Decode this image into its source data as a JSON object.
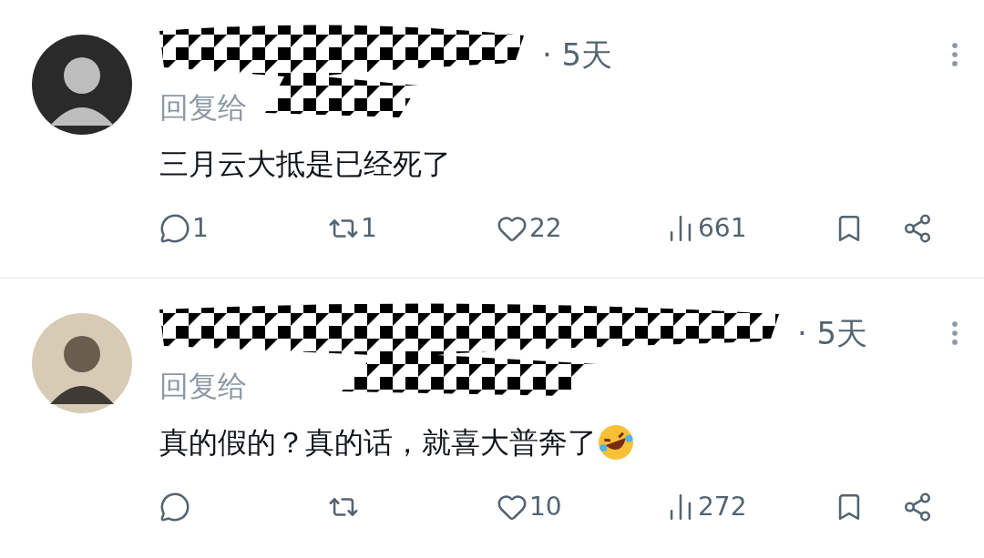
{
  "replies": [
    {
      "time": "· 5天",
      "reply_to": "回复给",
      "text": "三月云大抵是已经死了",
      "emoji": false,
      "actions": [
        {
          "kind": "reply",
          "count": "1"
        },
        {
          "kind": "repost",
          "count": "1"
        },
        {
          "kind": "like",
          "count": "22"
        },
        {
          "kind": "views",
          "count": "661"
        },
        {
          "kind": "bookmark"
        },
        {
          "kind": "share"
        }
      ]
    },
    {
      "time": "· 5天",
      "reply_to": "回复给",
      "text": "真的假的？真的话，就喜大普奔了",
      "emoji": true,
      "actions": [
        {
          "kind": "reply"
        },
        {
          "kind": "repost"
        },
        {
          "kind": "like",
          "count": "10"
        },
        {
          "kind": "views",
          "count": "272"
        },
        {
          "kind": "bookmark"
        },
        {
          "kind": "share"
        }
      ]
    }
  ]
}
